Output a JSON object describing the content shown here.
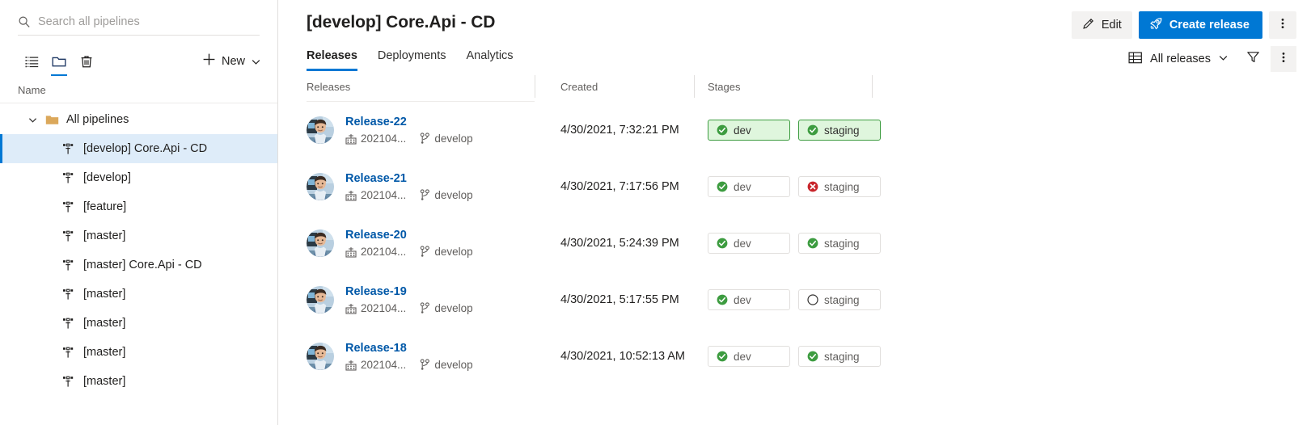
{
  "sidebar": {
    "search": {
      "placeholder": "Search all pipelines",
      "value": "",
      "icon": "search-icon"
    },
    "toolbar": {
      "view_list_icon": "list-view-icon",
      "view_folder_icon": "folder-view-icon",
      "delete_icon": "trash-icon",
      "new_label": "New",
      "new_plus_icon": "plus-icon",
      "new_chevron_icon": "chevron-down-icon"
    },
    "column_header": "Name",
    "root": {
      "label": "All pipelines",
      "icon": "folder-icon",
      "caret": "chevron-down-icon",
      "expanded": true
    },
    "items": [
      {
        "label": "[develop] Core.Api - CD",
        "icon": "release-pipeline-icon",
        "selected": true
      },
      {
        "label": "[develop]",
        "icon": "release-pipeline-icon",
        "selected": false
      },
      {
        "label": "[feature]",
        "icon": "release-pipeline-icon",
        "selected": false
      },
      {
        "label": "[master]",
        "icon": "release-pipeline-icon",
        "selected": false
      },
      {
        "label": "[master] Core.Api - CD",
        "icon": "release-pipeline-icon",
        "selected": false
      },
      {
        "label": "[master]",
        "icon": "release-pipeline-icon",
        "selected": false
      },
      {
        "label": "[master]",
        "icon": "release-pipeline-icon",
        "selected": false
      },
      {
        "label": "[master]",
        "icon": "release-pipeline-icon",
        "selected": false
      },
      {
        "label": "[master]",
        "icon": "release-pipeline-icon",
        "selected": false
      }
    ]
  },
  "header": {
    "title": "[develop] Core.Api - CD",
    "edit_label": "Edit",
    "edit_icon": "pencil-icon",
    "create_release_label": "Create release",
    "create_release_icon": "rocket-icon",
    "more_icon": "more-vertical-icon",
    "accent_color": "#0078d4"
  },
  "tabs": [
    {
      "label": "Releases",
      "active": true
    },
    {
      "label": "Deployments",
      "active": false
    },
    {
      "label": "Analytics",
      "active": false
    }
  ],
  "toolbar": {
    "view_label": "All releases",
    "view_icon": "table-icon",
    "view_chevron_icon": "chevron-down-icon",
    "filter_icon": "funnel-icon",
    "more_icon": "more-vertical-icon"
  },
  "table": {
    "columns": [
      "Releases",
      "Created",
      "Stages"
    ],
    "rows": [
      {
        "name": "Release-22",
        "build": "202104...",
        "build_icon": "build-icon",
        "branch": "develop",
        "branch_icon": "branch-icon",
        "avatar": "user-avatar",
        "created": "4/30/2021, 7:32:21 PM",
        "stages": [
          {
            "label": "dev",
            "status": "succeeded",
            "highlighted": true
          },
          {
            "label": "staging",
            "status": "succeeded",
            "highlighted": true
          }
        ]
      },
      {
        "name": "Release-21",
        "build": "202104...",
        "build_icon": "build-icon",
        "branch": "develop",
        "branch_icon": "branch-icon",
        "avatar": "user-avatar",
        "created": "4/30/2021, 7:17:56 PM",
        "stages": [
          {
            "label": "dev",
            "status": "succeeded",
            "highlighted": false
          },
          {
            "label": "staging",
            "status": "failed",
            "highlighted": false
          }
        ]
      },
      {
        "name": "Release-20",
        "build": "202104...",
        "build_icon": "build-icon",
        "branch": "develop",
        "branch_icon": "branch-icon",
        "avatar": "user-avatar",
        "created": "4/30/2021, 5:24:39 PM",
        "stages": [
          {
            "label": "dev",
            "status": "succeeded",
            "highlighted": false
          },
          {
            "label": "staging",
            "status": "succeeded",
            "highlighted": false
          }
        ]
      },
      {
        "name": "Release-19",
        "build": "202104...",
        "build_icon": "build-icon",
        "branch": "develop",
        "branch_icon": "branch-icon",
        "avatar": "user-avatar",
        "created": "4/30/2021, 5:17:55 PM",
        "stages": [
          {
            "label": "dev",
            "status": "succeeded",
            "highlighted": false
          },
          {
            "label": "staging",
            "status": "not-deployed",
            "highlighted": false
          }
        ]
      },
      {
        "name": "Release-18",
        "build": "202104...",
        "build_icon": "build-icon",
        "branch": "develop",
        "branch_icon": "branch-icon",
        "avatar": "user-avatar",
        "created": "4/30/2021, 10:52:13 AM",
        "stages": [
          {
            "label": "dev",
            "status": "succeeded",
            "highlighted": false
          },
          {
            "label": "staging",
            "status": "succeeded",
            "highlighted": false
          }
        ]
      }
    ]
  },
  "colors": {
    "accent": "#0078d4",
    "success": "#3d9c40",
    "failure": "#d13438",
    "success_bg": "#dff6dd",
    "link": "#0058a8",
    "selection_bg": "#deecf9"
  }
}
